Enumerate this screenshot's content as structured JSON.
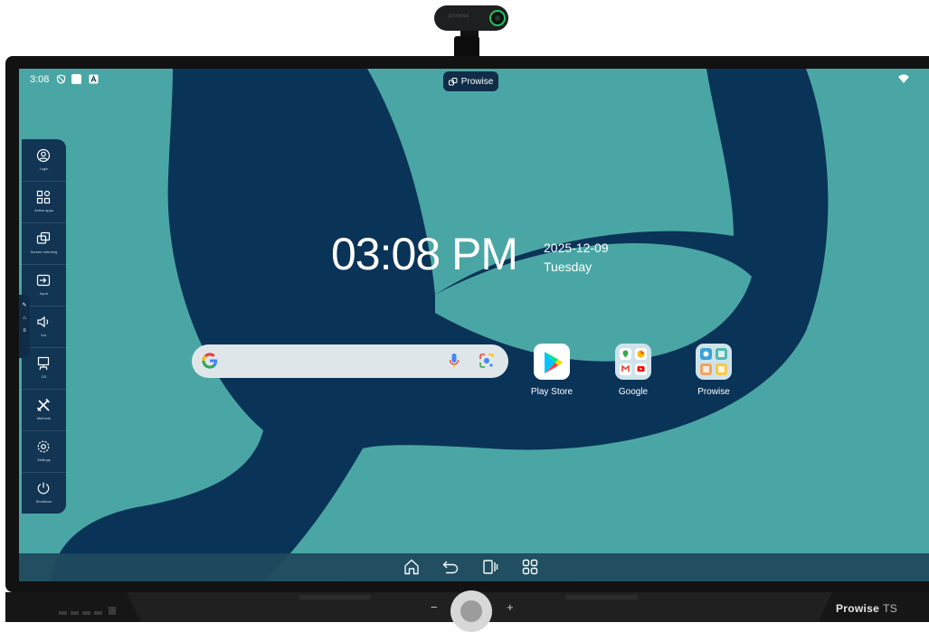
{
  "webcam": {
    "brand": "prowise"
  },
  "status_bar": {
    "time": "3:08",
    "center_badge": "Prowise"
  },
  "sidebar": {
    "items": [
      {
        "icon": "user-circle-icon",
        "label": "Login"
      },
      {
        "icon": "active-apps-icon",
        "label": "Active apps"
      },
      {
        "icon": "screen-mirroring-icon",
        "label": "Screen mirroring"
      },
      {
        "icon": "input-icon",
        "label": "Input"
      },
      {
        "icon": "volume-icon",
        "label": "Vol."
      },
      {
        "icon": "presenter-icon",
        "label": "D3"
      },
      {
        "icon": "tools-icon",
        "label": "Methods"
      },
      {
        "icon": "settings-icon",
        "label": "Settings"
      },
      {
        "icon": "power-icon",
        "label": "Shutdown"
      }
    ]
  },
  "clock": {
    "time": "03:08 PM",
    "date": "2025-12-09",
    "day": "Tuesday"
  },
  "search": {
    "placeholder": ""
  },
  "apps": [
    {
      "name": "Play Store",
      "icon": "play-store-icon"
    },
    {
      "name": "Google",
      "icon": "google-folder-icon"
    },
    {
      "name": "Prowise",
      "icon": "prowise-folder-icon"
    }
  ],
  "navbar": {
    "buttons": [
      "home-icon",
      "back-icon",
      "recent-apps-icon",
      "app-drawer-icon"
    ]
  },
  "bezel": {
    "brand": "Prowise",
    "model": "TS",
    "minus": "−",
    "plus": "+"
  },
  "colors": {
    "screen_bg": "#4aa6a4",
    "shape": "#0a3358",
    "sidebar": "#123554",
    "navbar": "#1f4a5e"
  }
}
